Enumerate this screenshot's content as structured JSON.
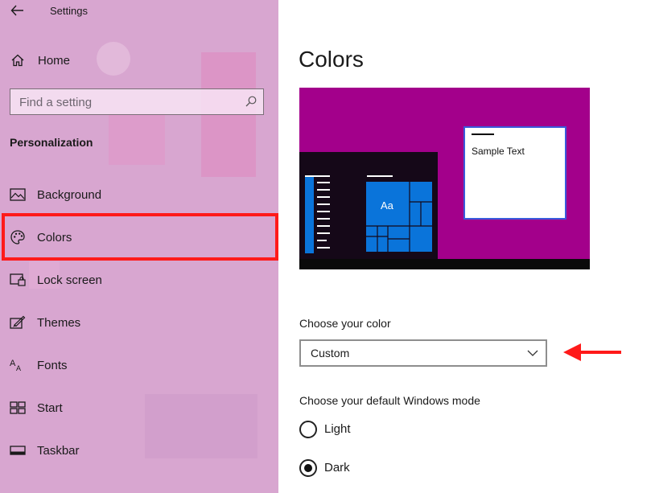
{
  "window": {
    "title": "Settings"
  },
  "sidebar": {
    "home_label": "Home",
    "search": {
      "placeholder": "Find a setting"
    },
    "section": "Personalization",
    "items": [
      {
        "id": "background",
        "label": "Background",
        "icon": "image-icon"
      },
      {
        "id": "colors",
        "label": "Colors",
        "icon": "palette-icon",
        "selected": true
      },
      {
        "id": "lock-screen",
        "label": "Lock screen",
        "icon": "lock-screen-icon"
      },
      {
        "id": "themes",
        "label": "Themes",
        "icon": "themes-icon"
      },
      {
        "id": "fonts",
        "label": "Fonts",
        "icon": "fonts-icon"
      },
      {
        "id": "start",
        "label": "Start",
        "icon": "start-icon"
      },
      {
        "id": "taskbar",
        "label": "Taskbar",
        "icon": "taskbar-icon"
      }
    ]
  },
  "main": {
    "title": "Colors",
    "preview": {
      "sample_text": "Sample Text",
      "tile_text": "Aa",
      "accent_color": "#a3008b",
      "tile_color": "#0a74da"
    },
    "choose_color": {
      "label": "Choose your color",
      "value": "Custom"
    },
    "windows_mode": {
      "label": "Choose your default Windows mode",
      "options": [
        {
          "label": "Light",
          "selected": false
        },
        {
          "label": "Dark",
          "selected": true
        }
      ]
    }
  },
  "colors": {
    "sidebar_bg": "#d8a6d0",
    "highlight_outline": "#ff1a1a",
    "annotation_arrow": "#ff1a1a"
  }
}
